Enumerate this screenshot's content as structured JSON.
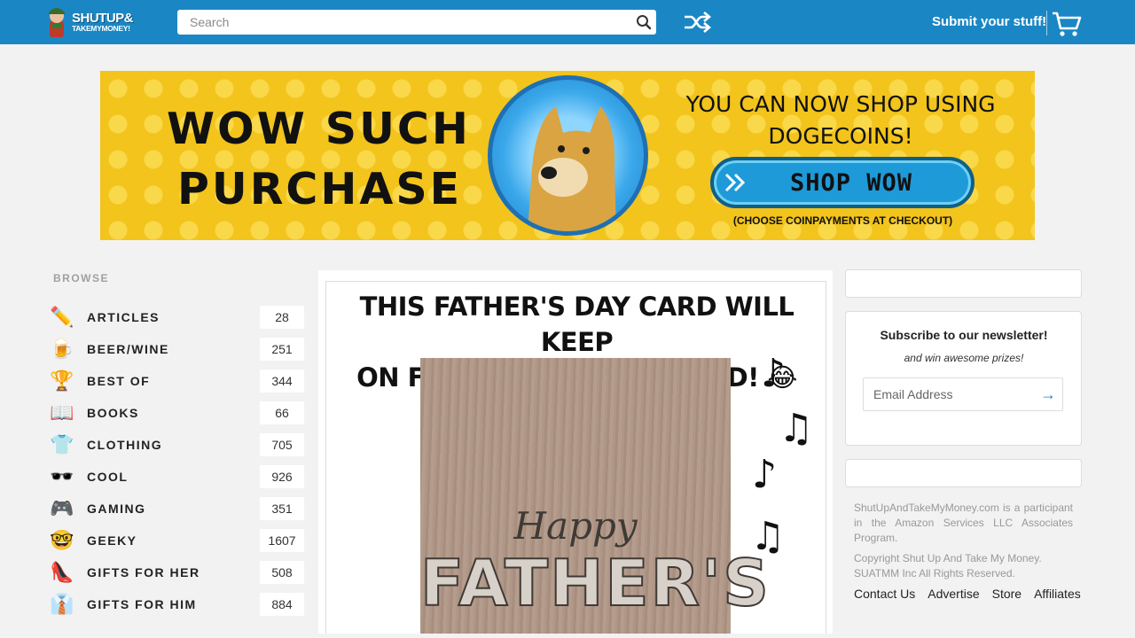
{
  "header": {
    "logo_line1": "SHUTUP&",
    "logo_line2": "TAKEMYMONEY!",
    "search_placeholder": "Search",
    "submit_label": "Submit your stuff!",
    "icons": {
      "search": "search-icon",
      "shuffle": "shuffle-icon",
      "cart": "cart-icon"
    }
  },
  "banner": {
    "headline_line1": "WOW SUCH",
    "headline_line2": "PURCHASE",
    "right_line1": "YOU CAN NOW SHOP USING",
    "right_line2": "DOGECOINS!",
    "button_label": "SHOP WOW",
    "note": "(CHOOSE COINPAYMENTS AT CHECKOUT)"
  },
  "sidebar": {
    "title": "BROWSE",
    "categories": [
      {
        "label": "ARTICLES",
        "count": "28",
        "icon": "✏️"
      },
      {
        "label": "BEER/WINE",
        "count": "251",
        "icon": "🍺"
      },
      {
        "label": "BEST OF",
        "count": "344",
        "icon": "🏆"
      },
      {
        "label": "BOOKS",
        "count": "66",
        "icon": "📖"
      },
      {
        "label": "CLOTHING",
        "count": "705",
        "icon": "👕"
      },
      {
        "label": "COOL",
        "count": "926",
        "icon": "🕶️"
      },
      {
        "label": "GAMING",
        "count": "351",
        "icon": "🎮"
      },
      {
        "label": "GEEKY",
        "count": "1607",
        "icon": "🤓"
      },
      {
        "label": "GIFTS FOR HER",
        "count": "508",
        "icon": "👠"
      },
      {
        "label": "GIFTS FOR HIM",
        "count": "884",
        "icon": "👔"
      }
    ]
  },
  "main": {
    "card_title_line1": "THIS FATHER'S DAY CARD WILL KEEP",
    "card_title_line2": "ON FARTING WHEN OPENED! 😂",
    "photo_text_1": "Happy",
    "photo_text_2": "FATHER'S"
  },
  "newsletter": {
    "title": "Subscribe to our newsletter!",
    "subtitle": "and win awesome prizes!",
    "email_placeholder": "Email Address"
  },
  "footer": {
    "legal_1": "ShutUpAndTakeMyMoney.com is a participant in the Amazon Services LLC Associates Program.",
    "legal_2": "Copyright Shut Up And Take My Money. SUATMM Inc All Rights Reserved.",
    "links": [
      "Contact Us",
      "Advertise",
      "Store",
      "Affiliates"
    ]
  },
  "colors": {
    "header_bg": "#1a87c4",
    "banner_bg": "#f2c41c",
    "shop_button": "#1e9ad9"
  }
}
